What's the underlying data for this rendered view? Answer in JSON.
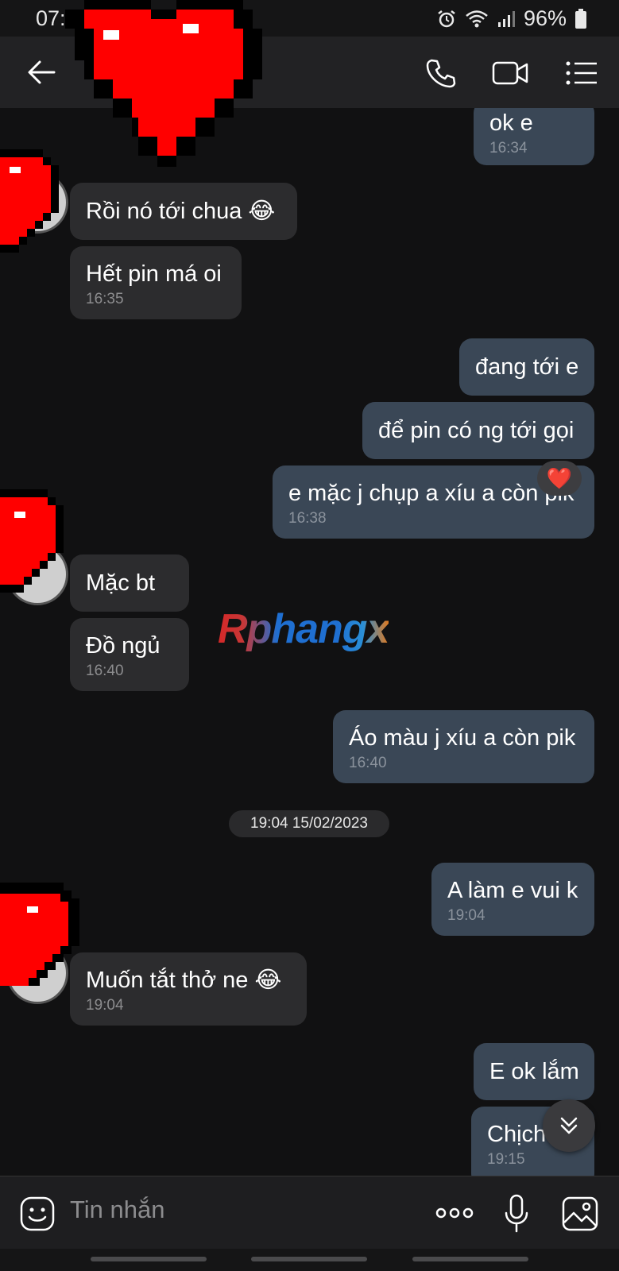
{
  "status": {
    "time": "07:34",
    "battery": "96%"
  },
  "header": {
    "back_icon": "back-arrow-icon",
    "call_icon": "phone-icon",
    "video_icon": "video-icon",
    "menu_icon": "list-menu-icon"
  },
  "messages": [
    {
      "dir": "out",
      "text": "ok e",
      "time": "16:34"
    },
    {
      "dir": "in",
      "text": "Rồi nó tới chua 😂",
      "time": ""
    },
    {
      "dir": "in",
      "text": "Hết pin má oi",
      "time": "16:35"
    },
    {
      "dir": "out",
      "text": "đang tới e",
      "time": ""
    },
    {
      "dir": "out",
      "text": "để pin có ng tới gọi",
      "time": ""
    },
    {
      "dir": "out",
      "text": "e mặc j chụp a xíu a còn pik",
      "time": "16:38",
      "reaction": "❤️"
    },
    {
      "dir": "in",
      "text": "Mặc bt",
      "time": ""
    },
    {
      "dir": "in",
      "text": "Đồ ngủ",
      "time": "16:40"
    },
    {
      "dir": "out",
      "text": "Áo màu j xíu a còn pik",
      "time": "16:40"
    },
    {
      "dir": "out",
      "text": "A làm e vui k",
      "time": "19:04"
    },
    {
      "dir": "in",
      "text": "Muốn tắt thở ne 😂",
      "time": "19:04"
    },
    {
      "dir": "out",
      "text": "E ok lắm",
      "time": ""
    },
    {
      "dir": "out",
      "text": "Chịch",
      "time": "19:15"
    }
  ],
  "date_separator": "19:04 15/02/2023",
  "watermark": "Rphangx",
  "composer": {
    "placeholder": "Tin nhắn",
    "emoji_icon": "emoji-icon",
    "more_icon": "more-dots-icon",
    "mic_icon": "mic-icon",
    "gallery_icon": "image-icon"
  },
  "colors": {
    "background": "#111112",
    "incoming_bubble": "#2c2c2e",
    "outgoing_bubble": "#3a4756",
    "header": "#222224"
  }
}
